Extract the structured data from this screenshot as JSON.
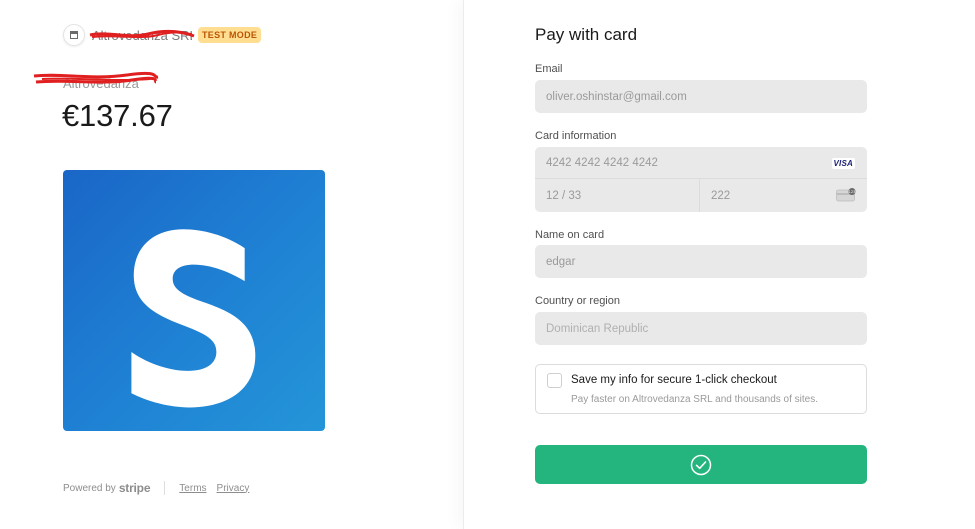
{
  "merchant": {
    "name": "Altrovedanza SRL",
    "test_badge": "TEST MODE"
  },
  "product": {
    "name": "Altrovedanza",
    "price": "€137.67"
  },
  "footer": {
    "powered_by": "Powered by",
    "brand": "stripe",
    "terms": "Terms",
    "privacy": "Privacy"
  },
  "form": {
    "title": "Pay with card",
    "email": {
      "label": "Email",
      "value": "oliver.oshinstar@gmail.com"
    },
    "card": {
      "label": "Card information",
      "number": "4242 4242 4242 4242",
      "brand": "VISA",
      "expiry": "12 / 33",
      "cvc": "222"
    },
    "name": {
      "label": "Name on card",
      "value": "edgar"
    },
    "country": {
      "label": "Country or region",
      "value": "Dominican Republic"
    },
    "save_info": {
      "title": "Save my info for secure 1-click checkout",
      "subtitle": "Pay faster on Altrovedanza SRL and thousands of sites."
    },
    "pay_button_icon": "check-circle-icon"
  },
  "colors": {
    "accent_green": "#24b47e",
    "badge_bg": "#ffde92",
    "badge_text": "#bb5504",
    "product_blue": "#1f82d4",
    "redaction_red": "#e02020"
  }
}
